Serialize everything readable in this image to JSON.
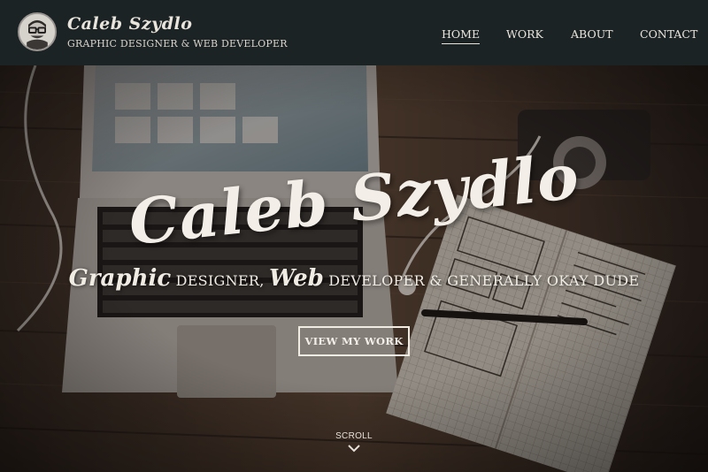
{
  "header": {
    "brand_name": "Caleb Szydlo",
    "brand_tagline": "GRAPHIC DESIGNER & WEB DEVELOPER",
    "nav": [
      {
        "label": "HOME",
        "active": true
      },
      {
        "label": "WORK",
        "active": false
      },
      {
        "label": "ABOUT",
        "active": false
      },
      {
        "label": "CONTACT",
        "active": false
      }
    ]
  },
  "hero": {
    "title": "Caleb Szydlo",
    "subtitle": {
      "word1": "Graphic",
      "text1": " DESIGNER, ",
      "word2": "Web",
      "text2": " DEVELOPER & GENERALLY OKAY DUDE"
    },
    "cta_label": "VIEW MY WORK",
    "scroll_label": "SCROLL"
  },
  "icons": {
    "logo": "glasses-avatar-icon",
    "scroll": "chevron-down-icon"
  },
  "colors": {
    "header_bg": "#1c2325",
    "text_light": "#f3efe8",
    "wood_dark": "#2f2620",
    "wood_mid": "#5a4536"
  }
}
